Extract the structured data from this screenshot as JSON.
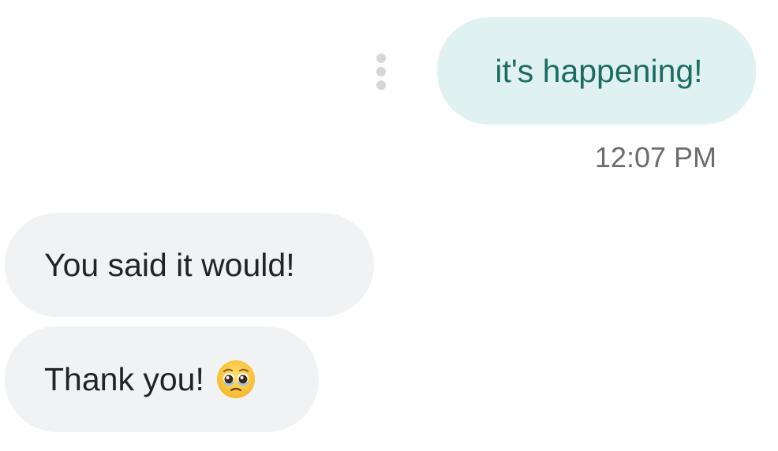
{
  "messages": [
    {
      "direction": "sent",
      "text": "it's happening!",
      "time": "12:07 PM"
    },
    {
      "direction": "received",
      "text": "You said it would!"
    },
    {
      "direction": "received",
      "text": "Thank you!",
      "emoji": "pleading-face-icon"
    }
  ],
  "colors": {
    "sent_bubble": "#e0f1f2",
    "sent_text": "#1d6b63",
    "received_bubble": "#f1f2f4",
    "received_text": "#222326",
    "timestamp": "#6a6c70"
  }
}
